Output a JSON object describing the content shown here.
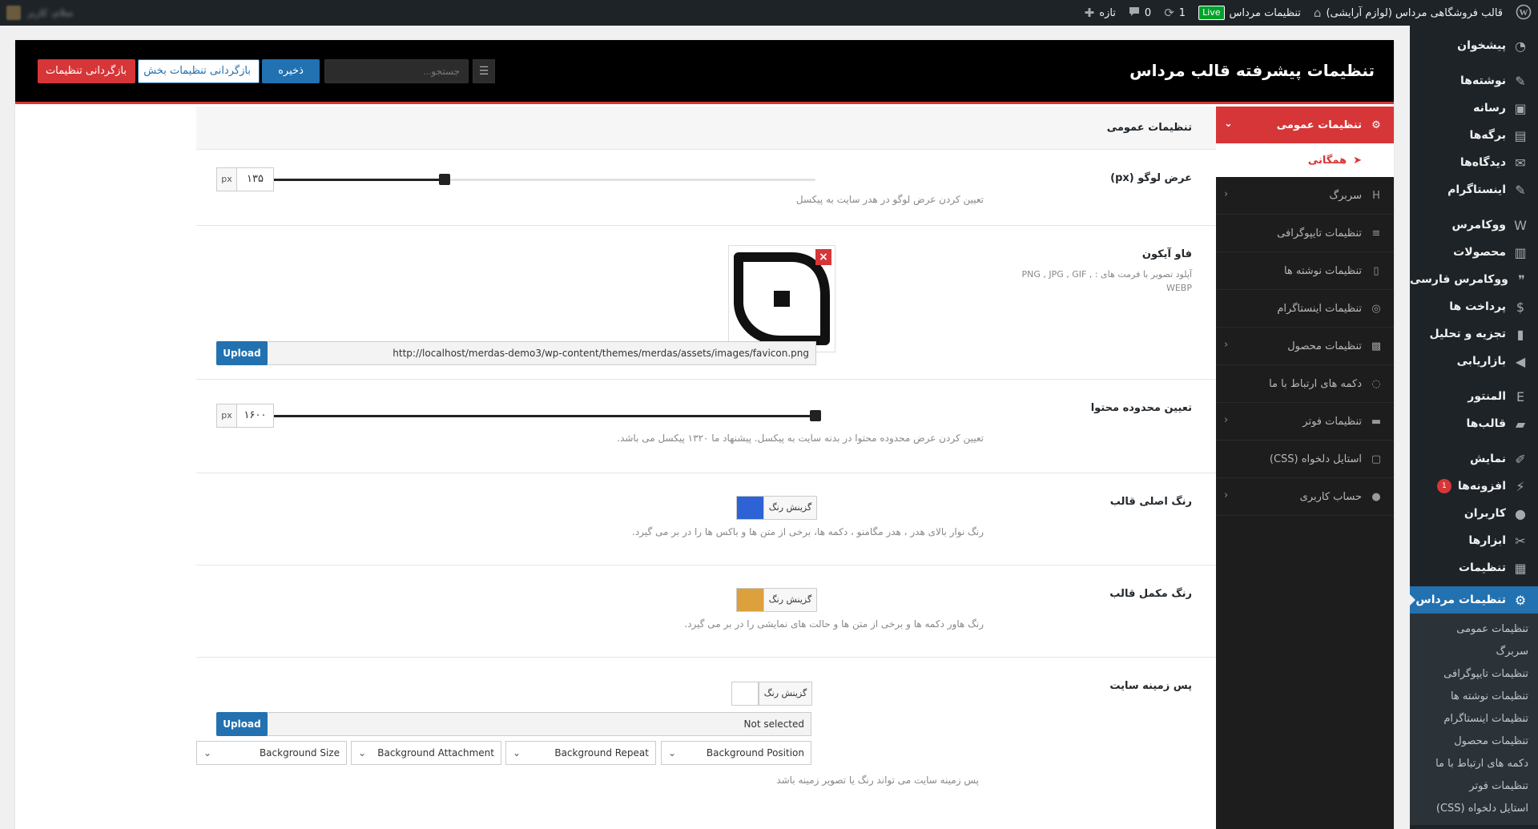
{
  "adminbar": {
    "site_name": "قالب فروشگاهی مرداس (لوازم آرایشی)",
    "live_badge": "Live",
    "settings_link": "تنظیمات مرداس",
    "updates_count": "1",
    "comments_count": "0",
    "new_label": "تازه",
    "blurred_user": "سلام، کاربر"
  },
  "adminmenu": {
    "items": [
      {
        "label": "پیشخوان",
        "icon": "dashboard-icon"
      },
      {
        "label": "نوشته‌ها",
        "icon": "pin-icon"
      },
      {
        "label": "رسانه",
        "icon": "media-icon"
      },
      {
        "label": "برگه‌ها",
        "icon": "page-icon"
      },
      {
        "label": "دیدگاه‌ها",
        "icon": "comment-icon"
      },
      {
        "label": "اینستاگرام",
        "icon": "pin-icon"
      },
      {
        "label": "ووکامرس",
        "icon": "woo-icon"
      },
      {
        "label": "محصولات",
        "icon": "archive-icon"
      },
      {
        "label": "ووکامرس فارسی",
        "icon": "quote-icon"
      },
      {
        "label": "پرداخت ها",
        "icon": "money-icon"
      },
      {
        "label": "تجزیه و تحلیل",
        "icon": "chart-icon"
      },
      {
        "label": "بازاریابی",
        "icon": "megaphone-icon"
      },
      {
        "label": "المنتور",
        "icon": "elementor-icon"
      },
      {
        "label": "قالب‌ها",
        "icon": "folder-icon"
      },
      {
        "label": "نمایش",
        "icon": "brush-icon"
      },
      {
        "label": "افزونه‌ها",
        "icon": "plugin-icon",
        "badge": "1"
      },
      {
        "label": "کاربران",
        "icon": "user-icon"
      },
      {
        "label": "ابزارها",
        "icon": "wrench-icon"
      },
      {
        "label": "تنظیمات",
        "icon": "settings-icon"
      }
    ],
    "current": {
      "label": "تنظیمات مرداس",
      "icon": "gear-icon"
    },
    "submenu": [
      "تنظیمات عمومی",
      "سربرگ",
      "تنظیمات تایپوگرافی",
      "تنظیمات نوشته ها",
      "تنظیمات اینستاگرام",
      "تنظیمات محصول",
      "دکمه های ارتباط با ما",
      "تنظیمات فوتر",
      "استایل دلخواه (CSS)"
    ]
  },
  "panel": {
    "title": "تنظیمات پیشرفته قالب مرداس",
    "search_placeholder": "جستجو...",
    "save_label": "ذخیره",
    "reset_section_label": "بازگردانی تنظیمات بخش",
    "reset_all_label": "بازگردانی تنظیمات"
  },
  "nav": {
    "active": {
      "label": "تنظیمات عمومی",
      "icon": "gear-icon"
    },
    "active_sub": {
      "label": "همگانی",
      "icon": "pointer-icon"
    },
    "items": [
      {
        "label": "سربرگ",
        "icon": "heading-icon",
        "arrow": true
      },
      {
        "label": "تنظیمات تایپوگرافی",
        "icon": "align-icon",
        "arrow": false
      },
      {
        "label": "تنظیمات نوشته ها",
        "icon": "book-icon",
        "arrow": false
      },
      {
        "label": "تنظیمات اینستاگرام",
        "icon": "instagram-icon",
        "arrow": false
      },
      {
        "label": "تنظیمات محصول",
        "icon": "box-icon",
        "arrow": true
      },
      {
        "label": "دکمه های ارتباط با ما",
        "icon": "chat-icon",
        "arrow": false
      },
      {
        "label": "تنظیمات فوتر",
        "icon": "footer-icon",
        "arrow": true
      },
      {
        "label": "استایل دلخواه (CSS)",
        "icon": "css-icon",
        "arrow": false
      },
      {
        "label": "حساب کاربری",
        "icon": "user-icon",
        "arrow": true
      }
    ]
  },
  "content": {
    "section_title": "تنظیمات عمومی",
    "logo_width": {
      "title": "عرض لوگو (px)",
      "desc": "تعیین کردن عرض لوگو در هدر سایت به پیکسل",
      "value": "۱۳۵",
      "unit": "px",
      "fraction": 0.339
    },
    "favicon": {
      "title": "فاو آیکون",
      "subtitle": "آپلود تصویر با فرمت های : PNG , JPG , GIF , WEBP",
      "url": "http://localhost/merdas-demo3/wp-content/themes/merdas/assets/images/favicon.png",
      "upload_label": "Upload",
      "remove_label": "×"
    },
    "content_width": {
      "title": "تعیین محدوده محتوا",
      "desc": "تعیین کردن عرض محدوده محتوا در بدنه سایت به پیکسل. پیشنهاد ما ۱۳۲۰ پیکسل می باشد.",
      "value": "۱۶۰۰",
      "unit": "px",
      "fraction": 1.0
    },
    "primary_color": {
      "title": "رنگ اصلی قالب",
      "desc": "رنگ نوار بالای هدر ، هدر مگامنو ، دکمه ها، برخی از متن ها و باکس ها را در بر می گیرد.",
      "button_label": "گزینش رنگ",
      "color": "#2e63d5"
    },
    "secondary_color": {
      "title": "رنگ مکمل قالب",
      "desc": "رنگ هاور دکمه ها و برخی از متن ها و حالت های نمایشی را در بر می گیرد.",
      "button_label": "گزینش رنگ",
      "color": "#dca13c"
    },
    "background": {
      "title": "پس زمینه سایت",
      "button_label": "گزینش رنگ",
      "color": "#ffffff",
      "image_value": "Not selected",
      "upload_label": "Upload",
      "position_label": "Background Position",
      "repeat_label": "Background Repeat",
      "attachment_label": "Background Attachment",
      "size_label": "Background Size",
      "desc": "پس زمینه سایت می تواند رنگ یا تصویر زمینه باشد"
    }
  }
}
